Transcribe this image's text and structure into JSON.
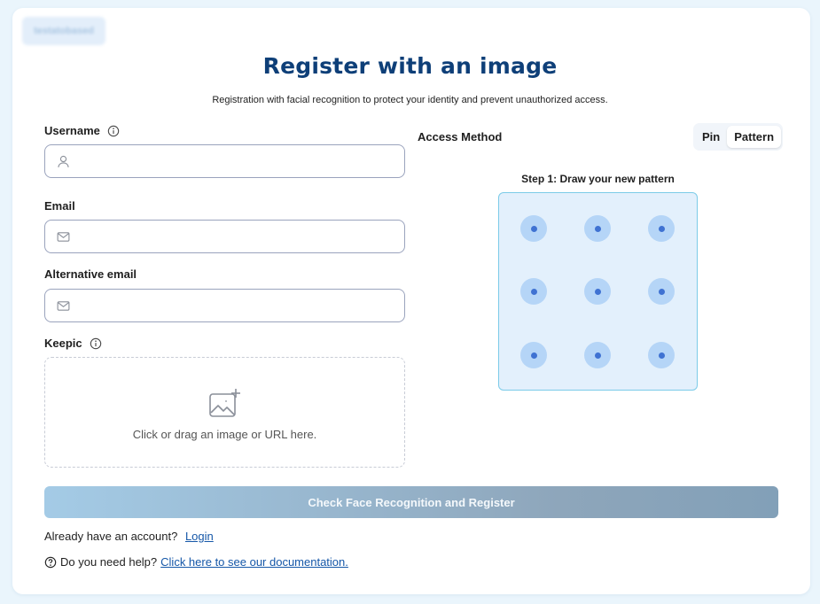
{
  "logo": {
    "text": "testatobased"
  },
  "header": {
    "title": "Register with an image",
    "subtitle": "Registration with facial recognition to protect your identity and prevent unauthorized access."
  },
  "form": {
    "username": {
      "label": "Username",
      "value": "",
      "icon": "user-icon"
    },
    "email": {
      "label": "Email",
      "value": "",
      "icon": "mail-icon"
    },
    "alt_email": {
      "label": "Alternative email",
      "value": "",
      "icon": "mail-icon"
    },
    "keepic": {
      "label": "Keepic",
      "drop_text": "Click or drag an image or URL here.",
      "icon": "image-add-icon"
    }
  },
  "access": {
    "label": "Access Method",
    "options": [
      "Pin",
      "Pattern"
    ],
    "selected": "Pattern",
    "step_label": "Step 1: Draw your new pattern",
    "grid_size": 3
  },
  "actions": {
    "submit_label": "Check Face Recognition and Register"
  },
  "footer": {
    "account_text": "Already have an account?",
    "login_link": "Login",
    "help_text": "Do you need help?",
    "docs_link": "Click here to see our documentation."
  },
  "colors": {
    "title": "#0e3f78",
    "link": "#1557a8",
    "pattern_bg": "#e3f0fc",
    "pattern_dot": "#3f72d2",
    "pattern_halo": "#b5d5f7",
    "page_bg": "#eaf5fc"
  }
}
